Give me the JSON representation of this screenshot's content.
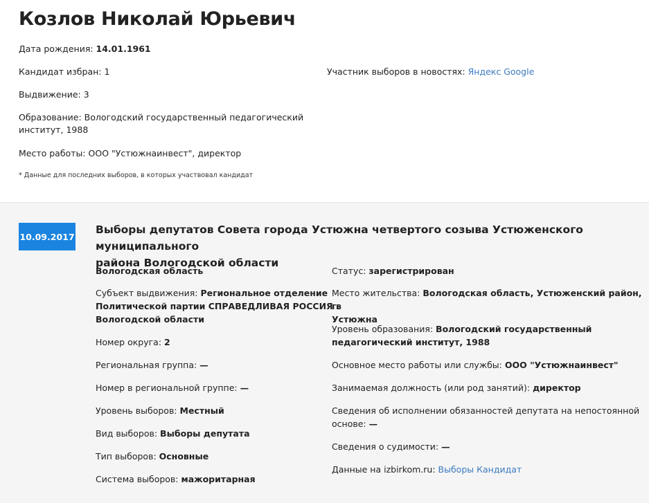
{
  "candidate": {
    "name": "Козлов Николай Юрьевич",
    "birth_label": "Дата рождения: ",
    "birth_value": "14.01.1961",
    "elected_label": "Кандидат избран: ",
    "elected_value": "1",
    "nomination_label": "Выдвижение: ",
    "nomination_value": "3",
    "education_label": "Образование: ",
    "education_value_1": "Вологодский государственный педагогический",
    "education_value_2": "институт, 1988",
    "work_label": "Место работы: ",
    "work_value": "ООО \"Устюжнаинвест\", директор",
    "note": "* Данные для последних выборов, в которых участвовал кандидат",
    "news_label": "Участник выборов в новостях: ",
    "news_link_1": "Яндекс",
    "news_link_2": "Google"
  },
  "election": {
    "date": "10.09.2017",
    "title_1": "Выборы депутатов Совета города Устюжна четвертого созыва Устюженского муниципального",
    "title_2": "района Вологодской области",
    "region": "Вологодская область",
    "subject_label": "Субъект выдвижения: ",
    "subject_value_1": "Региональное отделение",
    "subject_value_2": "Политической партии СПРАВЕДЛИВАЯ РОССИЯ в",
    "subject_value_3": "Вологодской области",
    "district_label": "Номер округа: ",
    "district_value": "2",
    "group_label": "Региональная группа: ",
    "group_value": "—",
    "group_num_label": "Номер в региональной группе: ",
    "group_num_value": "—",
    "level_label": "Уровень выборов: ",
    "level_value": "Местный",
    "kind_label": "Вид выборов: ",
    "kind_value": "Выборы депутата",
    "type_label": "Тип выборов: ",
    "type_value": "Основные",
    "system_label": "Система выборов: ",
    "system_value": "мажоритарная",
    "status_label": "Статус: ",
    "status_value": "зарегистрирован",
    "residence_label": "Место жительства: ",
    "residence_value_1": "Вологодская область, Устюженский район, г.",
    "residence_value_2": "Устюжна",
    "edu_label": "Уровень образования: ",
    "edu_value_1": "Вологодский государственный",
    "edu_value_2": "педагогический институт, 1988",
    "job_label": "Основное место работы или службы: ",
    "job_value": "ООО \"Устюжнаинвест\"",
    "position_label": "Занимаемая должность (или род занятий): ",
    "position_value": "директор",
    "duties_label_1": "Сведения об исполнении обязанностей депутата на непостоянной",
    "duties_label_2": "основе: ",
    "duties_value": "—",
    "criminal_label": "Сведения о судимости: ",
    "criminal_value": "—",
    "izbirkom_label": "Данные на izbirkom.ru: ",
    "izbirkom_link_1": "Выборы",
    "izbirkom_link_2": "Кандидат"
  }
}
